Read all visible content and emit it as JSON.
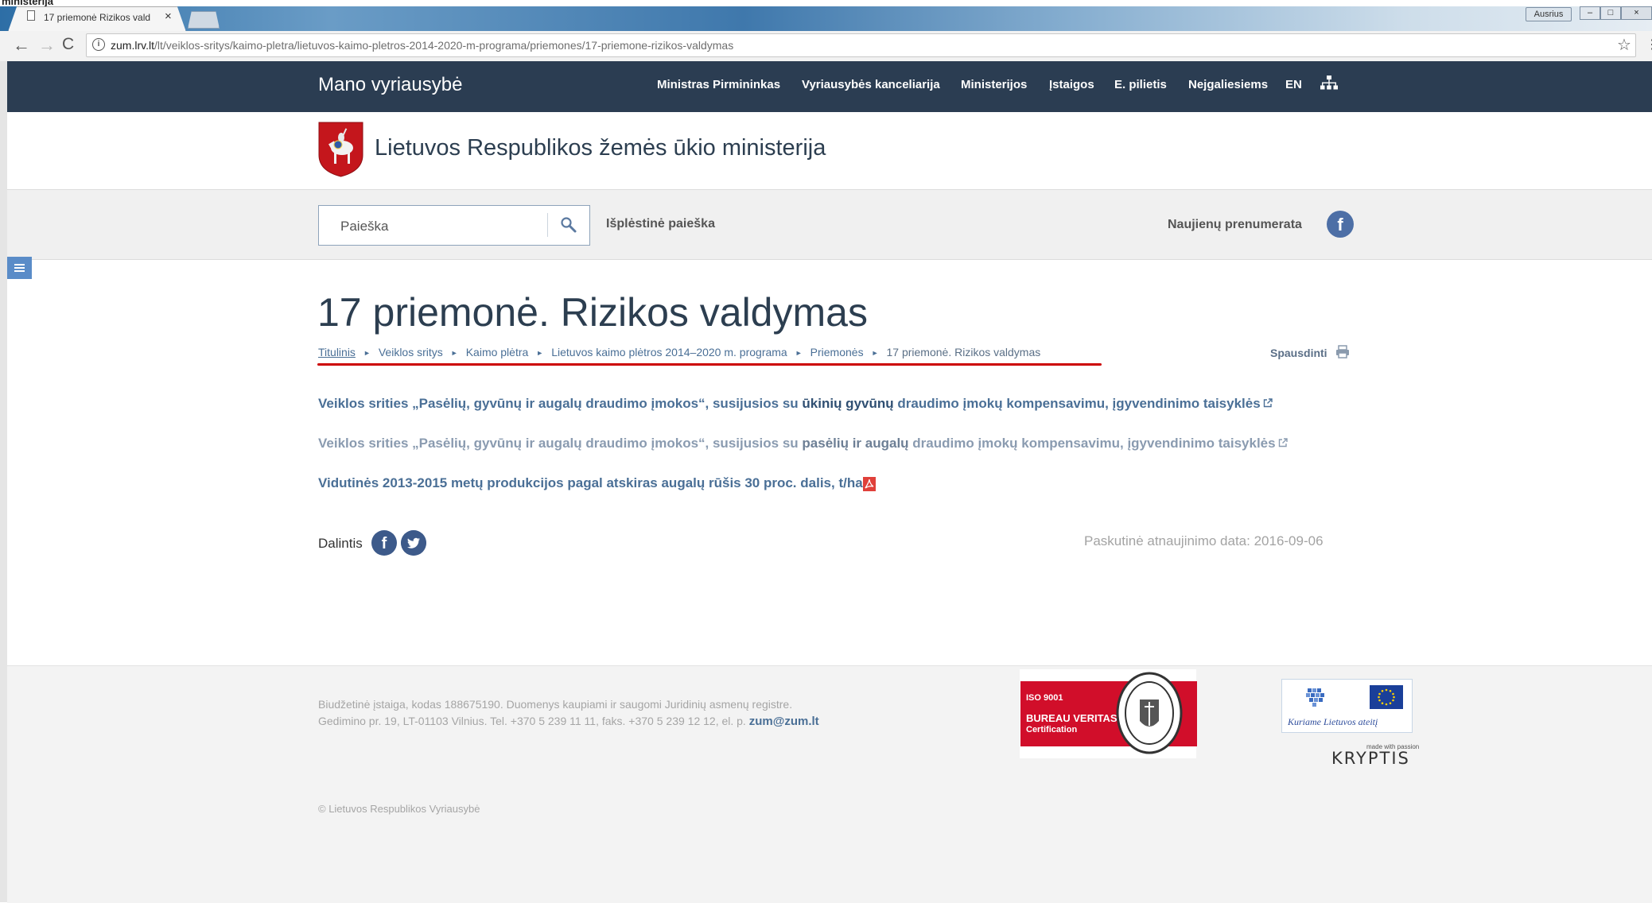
{
  "window": {
    "top_strip_text": "ministerija",
    "user_badge": "Ausrius",
    "tab": {
      "title": "17 priemonė Rizikos vald",
      "close": "×"
    },
    "controls": {
      "minimize": "–",
      "maximize": "□",
      "close": "×"
    }
  },
  "address_bar": {
    "host": "zum.lrv.lt",
    "path": "/lt/veiklos-sritys/kaimo-pletra/lietuvos-kaimo-pletros-2014-2020-m-programa/priemones/17-priemone-rizikos-valdymas",
    "back": "←",
    "forward": "→",
    "reload": "C",
    "info": "i",
    "star": "☆",
    "menu": "⋮"
  },
  "navbar": {
    "site_title": "Mano vyriausybė",
    "links": [
      "Ministras Pirmininkas",
      "Vyriausybės kanceliarija",
      "Ministerijos",
      "Įstaigos",
      "E. pilietis",
      "Nejgaliesiems",
      "EN"
    ]
  },
  "header": {
    "ministry_name": "Lietuvos Respublikos žemės ūkio ministerija"
  },
  "search": {
    "placeholder": "Paieška",
    "advanced": "Išplėstinė paieška",
    "newsletter": "Naujienų prenumerata",
    "facebook_letter": "f"
  },
  "main": {
    "title": "17 priemonė. Rizikos valdymas",
    "breadcrumb": [
      "Titulinis",
      "Veiklos sritys",
      "Kaimo plėtra",
      "Lietuvos kaimo plėtros 2014–2020 m. programa",
      "Priemonės",
      "17 priemonė. Rizikos valdymas"
    ],
    "breadcrumb_separator": "►",
    "print": "Spausdinti",
    "links": [
      {
        "before": "Veiklos srities „Pasėlių, gyvūnų ir augalų draudimo įmokos“, susijusios su ",
        "strong": "ūkinių gyvūnų",
        "after": " draudimo įmokų kompensavimu, įgyvendinimo taisyklės"
      },
      {
        "before": "Veiklos srities „Pasėlių, gyvūnų ir augalų draudimo įmokos“, susijusios su ",
        "strong": "pasėlių ir augalų",
        "after": " draudimo įmokų kompensavimu, įgyvendinimo taisyklės"
      },
      {
        "before": "Vidutinės 2013-2015 metų produkcijos pagal atskiras augalų rūšis 30 proc. dalis, t/ha",
        "strong": "",
        "after": ""
      }
    ],
    "share_label": "Dalintis",
    "share_facebook_letter": "f",
    "last_updated": "Paskutinė atnaujinimo data: 2016-09-06"
  },
  "footer": {
    "line1": "Biudžetinė įstaiga, kodas 188675190. Duomenys kaupiami ir saugomi Juridinių asmenų registre.",
    "line2": "Gedimino pr. 19, LT-01103 Vilnius. Tel. +370 5 239 11 11, faks. +370 5 239 12 12, el. p. ",
    "email": "zum@zum.lt",
    "copyright": "© Lietuvos Respublikos Vyriausybė",
    "bv": {
      "iso": "ISO 9001",
      "name": "BUREAU VERITAS",
      "cert": "Certification"
    },
    "eu_slogan": "Kuriame Lietuvos ateitį",
    "kryptis_tag": "made with passion",
    "kryptis": "KRYPTIS"
  },
  "colors": {
    "navbar": "#2b3d52",
    "link": "#4a6f96",
    "breadcrumb_underline": "#cc0000",
    "facebook": "#4d6fa6",
    "bv_red": "#d10e2a"
  }
}
